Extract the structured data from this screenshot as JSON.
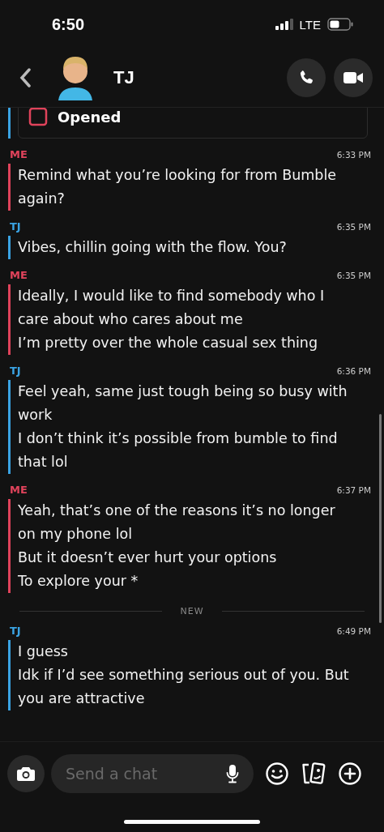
{
  "status_bar": {
    "time": "6:50",
    "network": "LTE"
  },
  "header": {
    "contact_name": "TJ"
  },
  "opened_card": {
    "label": "Opened",
    "color": "#3aa3e3"
  },
  "messages": [
    {
      "sender": "ME",
      "color": "#e0435b",
      "time": "6:33 PM",
      "lines": [
        "Remind what you’re looking for from Bumble again?"
      ]
    },
    {
      "sender": "TJ",
      "color": "#3aa3e3",
      "time": "6:35 PM",
      "lines": [
        "Vibes, chillin going with the flow. You?"
      ]
    },
    {
      "sender": "ME",
      "color": "#e0435b",
      "time": "6:35 PM",
      "lines": [
        "Ideally, I would like to find somebody who I care about who cares about me",
        "I’m pretty over the whole casual sex thing"
      ]
    },
    {
      "sender": "TJ",
      "color": "#3aa3e3",
      "time": "6:36 PM",
      "lines": [
        "Feel yeah, same just tough being so busy with work",
        "I don’t think it’s possible from bumble to find that lol"
      ]
    },
    {
      "sender": "ME",
      "color": "#e0435b",
      "time": "6:37 PM",
      "lines": [
        "Yeah, that’s one of the reasons it’s no longer on my phone lol",
        "But it doesn’t ever hurt your options",
        "To explore your *"
      ]
    },
    {
      "kind": "divider",
      "label": "NEW"
    },
    {
      "sender": "TJ",
      "color": "#3aa3e3",
      "time": "6:49 PM",
      "lines": [
        "I guess",
        "Idk if I’d see something serious out of you. But you are attractive"
      ]
    }
  ],
  "composer": {
    "placeholder": "Send a chat"
  }
}
